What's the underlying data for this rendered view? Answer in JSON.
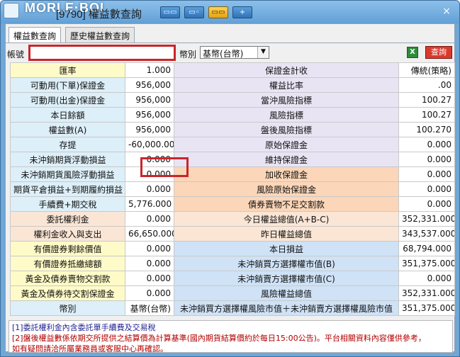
{
  "window": {
    "brand": "MORLE·BOI",
    "title": "[9790] 權益數查詢",
    "toolbar_buttons": [
      "▭▭",
      "▭◦",
      "▭▭",
      "+"
    ],
    "close": "×"
  },
  "tabs": [
    {
      "label": "權益數查詢",
      "active": true
    },
    {
      "label": "歷史權益數查詢",
      "active": false
    }
  ],
  "account": {
    "label": "帳號",
    "value": ""
  },
  "currency": {
    "label": "幣別",
    "selected": "基幣(台幣)"
  },
  "actions": {
    "excel_icon": "X",
    "query_label": "查詢"
  },
  "rows": [
    {
      "l1": "匯率",
      "v1": "1.000",
      "l2": "保證金計收",
      "v2": "傳統(策略)",
      "c1": "bg-yellow",
      "c2": "bg-lav"
    },
    {
      "l1": "可動用(下單)保證金",
      "v1": "956,000",
      "l2": "權益比率",
      "v2": ".00",
      "c1": "bg-blue1",
      "c2": "bg-lav"
    },
    {
      "l1": "可動用(出金)保證金",
      "v1": "956,000",
      "l2": "當沖風險指標",
      "v2": "100.27",
      "c1": "bg-blue1",
      "c2": "bg-lav"
    },
    {
      "l1": "本日餘額",
      "v1": "956,000",
      "l2": "風險指標",
      "v2": "100.27",
      "c1": "bg-blue1",
      "c2": "bg-lav"
    },
    {
      "l1": "權益數(A)",
      "v1": "956,000",
      "l2": "盤後風險指標",
      "v2": "100.270",
      "c1": "bg-blue1",
      "c2": "bg-lav"
    },
    {
      "l1": "存提",
      "v1": "-60,000.000",
      "l2": "原始保證金",
      "v2": "0.000",
      "c1": "bg-blue1",
      "c2": "bg-lav"
    },
    {
      "l1": "未沖銷期貨浮動損益",
      "v1": "0.000",
      "l2": "維持保證金",
      "v2": "0.000",
      "c1": "bg-blue1",
      "c2": "bg-lav"
    },
    {
      "l1": "未沖銷期貨風險浮動損益",
      "v1": "0.000",
      "l2": "加收保證金",
      "v2": "0.000",
      "c1": "bg-blue1",
      "c2": "bg-orange"
    },
    {
      "l1": "期貨平倉損益+到期履約損益",
      "v1": "0.000",
      "l2": "風險原始保證金",
      "v2": "0.000",
      "c1": "bg-blue1",
      "c2": "bg-orange"
    },
    {
      "l1": "手續費+期交稅",
      "v1": "5,776.000",
      "l2": "債券賣物不足交割款",
      "v2": "0.000",
      "c1": "bg-blue1",
      "c2": "bg-orange"
    },
    {
      "l1": "委託權利金",
      "v1": "0.000",
      "l2": "今日權益總值(A+B-C)",
      "v2": "352,331.000",
      "c1": "bg-salmon",
      "c2": "bg-salmon"
    },
    {
      "l1": "權利金收入與支出",
      "v1": "66,650.000",
      "l2": "昨日權益總值",
      "v2": "343,537.000",
      "c1": "bg-salmon",
      "c2": "bg-salmon"
    },
    {
      "l1": "有價證券剩餘價值",
      "v1": "0.000",
      "l2": "本日損益",
      "v2": "68,794.000",
      "c1": "bg-yellow",
      "c2": "bg-sky"
    },
    {
      "l1": "有價證券抵繳總額",
      "v1": "0.000",
      "l2": "未沖銷買方選擇權市值(B)",
      "v2": "351,375.000",
      "c1": "bg-yellow",
      "c2": "bg-sky"
    },
    {
      "l1": "黃金及債券賣物交割款",
      "v1": "0.000",
      "l2": "未沖銷賣方選擇權市值(C)",
      "v2": "0.000",
      "c1": "bg-yellow",
      "c2": "bg-sky"
    },
    {
      "l1": "黃金及債券待交割保證金",
      "v1": "0.000",
      "l2": "風險權益總值",
      "v2": "352,331.000",
      "c1": "bg-yellow",
      "c2": "bg-sky"
    },
    {
      "l1": "幣別",
      "v1": "基幣(台幣)",
      "l2": "未沖銷買方選擇權風險市值＋未沖銷賣方選擇權風險市值",
      "v2": "351,375.000",
      "c1": "bg-blue1",
      "c2": "bg-sky"
    }
  ],
  "notes": [
    "[1]委託權利金內含委託單手續費及交易稅",
    "[2]盤後權益數係依期交所提供之結算價為計算基準(國內期貨結算價約於每日15:00公告)。平台相關資料內容僅供參考，",
    "如有疑問請洽所屬業務員或客服中心再確認。"
  ]
}
